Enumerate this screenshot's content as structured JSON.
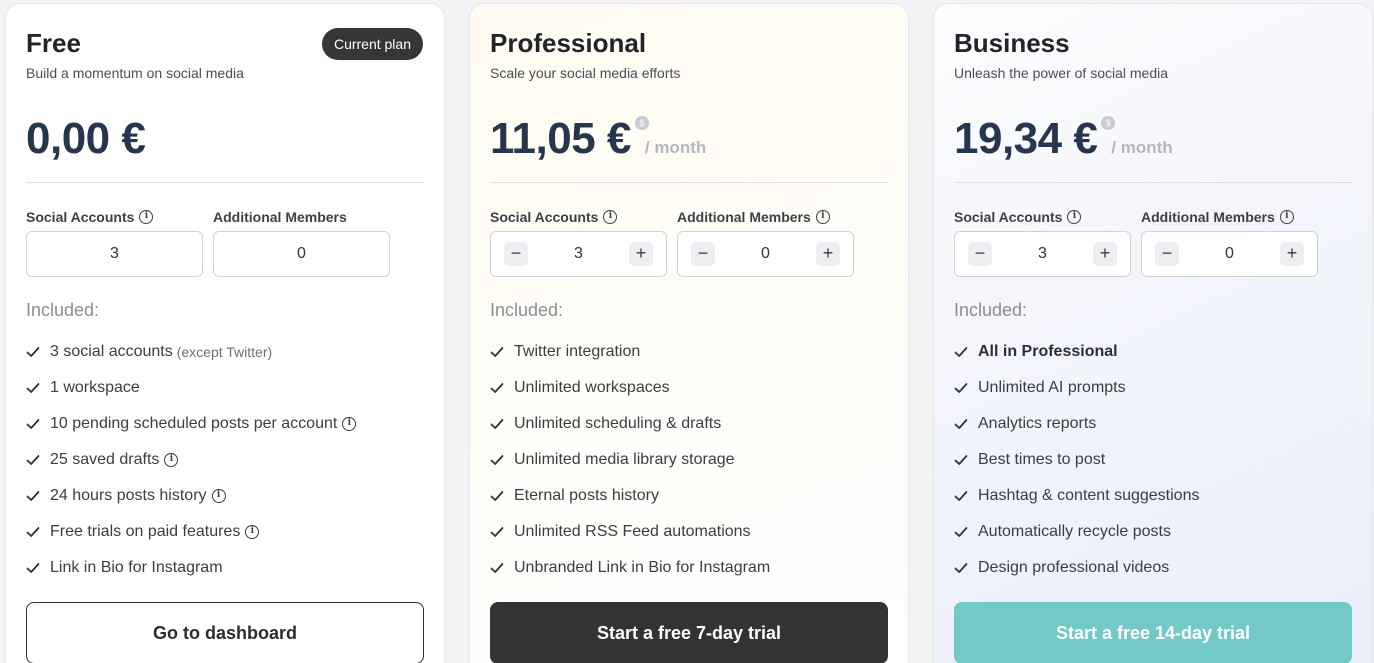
{
  "plans": [
    {
      "name": "Free",
      "badge": "Current plan",
      "tagline": "Build a momentum on social media",
      "price": "0,00 €",
      "social_label": "Social Accounts",
      "members_label": "Additional Members",
      "social_value": "3",
      "members_value": "0",
      "included_title": "Included:",
      "features": [
        {
          "text": "3 social accounts",
          "note": "(except Twitter)"
        },
        {
          "text": "1 workspace"
        },
        {
          "text": "10 pending scheduled posts per account",
          "info": true
        },
        {
          "text": "25 saved drafts",
          "info": true
        },
        {
          "text": "24 hours posts history",
          "info": true
        },
        {
          "text": "Free trials on paid features",
          "info": true
        },
        {
          "text": "Link in Bio for Instagram"
        }
      ],
      "cta": "Go to dashboard"
    },
    {
      "name": "Professional",
      "tagline": "Scale your social media efforts",
      "price": "11,05 €",
      "currency_badge": "$",
      "period": "/ month",
      "social_label": "Social Accounts",
      "members_label": "Additional Members",
      "social_value": "3",
      "members_value": "0",
      "minus": "−",
      "plus": "+",
      "included_title": "Included:",
      "features": [
        {
          "text": "Twitter integration"
        },
        {
          "text": "Unlimited workspaces"
        },
        {
          "text": "Unlimited scheduling & drafts"
        },
        {
          "text": "Unlimited media library storage"
        },
        {
          "text": "Eternal posts history"
        },
        {
          "text": "Unlimited RSS Feed automations"
        },
        {
          "text": "Unbranded Link in Bio for Instagram"
        }
      ],
      "cta": "Start a free 7-day trial"
    },
    {
      "name": "Business",
      "tagline": "Unleash the power of social media",
      "price": "19,34 €",
      "currency_badge": "$",
      "period": "/ month",
      "social_label": "Social Accounts",
      "members_label": "Additional Members",
      "social_value": "3",
      "members_value": "0",
      "minus": "−",
      "plus": "+",
      "included_title": "Included:",
      "features": [
        {
          "text": "All in Professional",
          "bold": true
        },
        {
          "text": "Unlimited AI prompts"
        },
        {
          "text": "Analytics reports"
        },
        {
          "text": "Best times to post"
        },
        {
          "text": "Hashtag & content suggestions"
        },
        {
          "text": "Automatically recycle posts"
        },
        {
          "text": "Design professional videos"
        }
      ],
      "cta": "Start a free 14-day trial"
    }
  ],
  "info_glyph": "i",
  "colors": {
    "price": "#26364e",
    "cta_dark": "#333333",
    "cta_teal": "#72c9c6"
  }
}
